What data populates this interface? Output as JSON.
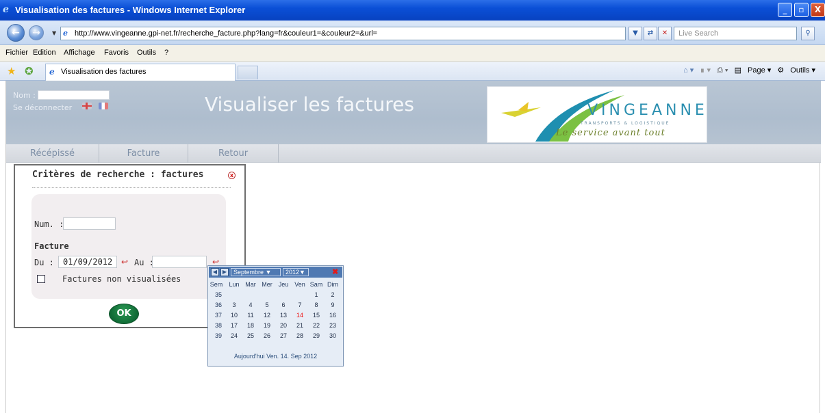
{
  "window": {
    "title": "Visualisation des factures - Windows Internet Explorer",
    "minimize": "_",
    "maximize": "▫",
    "close": "X"
  },
  "address": {
    "url": "http://www.vingeanne.gpi-net.fr/recherche_facture.php?lang=fr&couleur1=&couleur2=&url=",
    "search_placeholder": "Live Search"
  },
  "menu": [
    "Fichier",
    "Edition",
    "Affichage",
    "Favoris",
    "Outils",
    "?"
  ],
  "tab": {
    "label": "Visualisation des factures"
  },
  "commandbar": {
    "page": "Page",
    "tools": "Outils"
  },
  "header": {
    "name_label": "Nom :",
    "name_value": "",
    "logout": "Se déconnecter",
    "heading": "Visualiser les factures",
    "logo_word": "VINGEANNE",
    "logo_sub": "TRANSPORTS & LOGISTIQUE",
    "logo_tagline": "Le service avant tout"
  },
  "nav": [
    "Récépissé",
    "Facture",
    "Retour"
  ],
  "panel": {
    "title": "Critères de recherche : factures",
    "num_label": "Num. :",
    "num_value": "",
    "section": "Facture",
    "from_label": "Du :",
    "from_value": "01/09/2012",
    "to_label": "Au :",
    "to_value": "",
    "checkbox_label": "Factures non visualisées",
    "checkbox_checked": false,
    "ok": "OK"
  },
  "calendar": {
    "month": "Septembre",
    "year": "2012",
    "headers": [
      "Sem",
      "Lun",
      "Mar",
      "Mer",
      "Jeu",
      "Ven",
      "Sam",
      "Dim"
    ],
    "weeks": [
      {
        "week": "35",
        "days": [
          "",
          "",
          "",
          "",
          "",
          "1",
          "2"
        ]
      },
      {
        "week": "36",
        "days": [
          "3",
          "4",
          "5",
          "6",
          "7",
          "8",
          "9"
        ]
      },
      {
        "week": "37",
        "days": [
          "10",
          "11",
          "12",
          "13",
          "14",
          "15",
          "16"
        ]
      },
      {
        "week": "38",
        "days": [
          "17",
          "18",
          "19",
          "20",
          "21",
          "22",
          "23"
        ]
      },
      {
        "week": "39",
        "days": [
          "24",
          "25",
          "26",
          "27",
          "28",
          "29",
          "30"
        ]
      }
    ],
    "today_day": "14",
    "footer": "Aujourd'hui Ven. 14. Sep 2012"
  }
}
